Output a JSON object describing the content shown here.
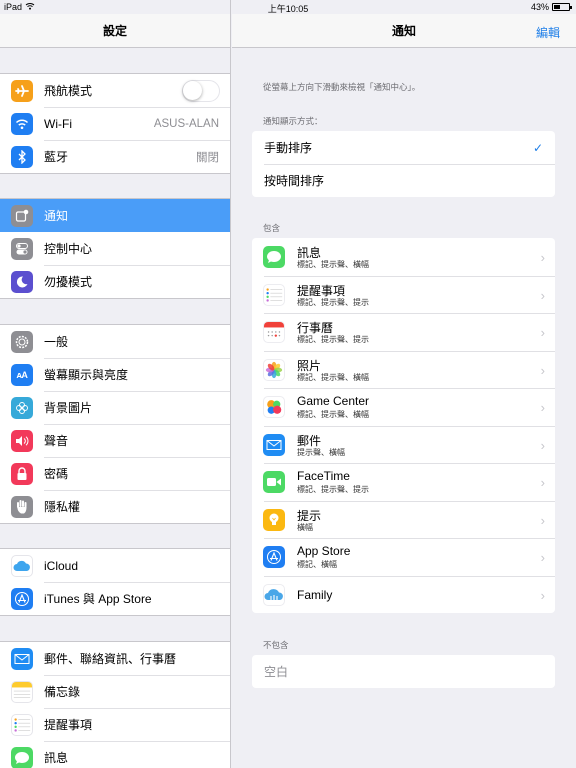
{
  "status_bar": {
    "device": "iPad",
    "time": "上午10:05",
    "battery_percent_label": "43%",
    "battery_level": 0.43
  },
  "master": {
    "title": "設定",
    "groups": [
      [
        {
          "label": "飛航模式",
          "icon": "airplane-icon",
          "color": "#f6a01a",
          "accessory": "toggle",
          "toggle_on": false
        },
        {
          "label": "Wi-Fi",
          "icon": "wifi-icon",
          "color": "#1f7ef2",
          "value": "ASUS-ALAN"
        },
        {
          "label": "藍牙",
          "icon": "bluetooth-icon",
          "color": "#1f7ef2",
          "value": "關閉"
        }
      ],
      [
        {
          "label": "通知",
          "icon": "notifications-icon",
          "color": "#8e8e93",
          "selected": true
        },
        {
          "label": "控制中心",
          "icon": "control-center-icon",
          "color": "#8e8e93"
        },
        {
          "label": "勿擾模式",
          "icon": "moon-icon",
          "color": "#5b4fcf"
        }
      ],
      [
        {
          "label": "一般",
          "icon": "gear-icon",
          "color": "#8e8e93"
        },
        {
          "label": "螢幕顯示與亮度",
          "icon": "display-icon",
          "color": "#1f7ef2"
        },
        {
          "label": "背景圖片",
          "icon": "wallpaper-icon",
          "color": "#36a9d9"
        },
        {
          "label": "聲音",
          "icon": "speaker-icon",
          "color": "#f2395a"
        },
        {
          "label": "密碼",
          "icon": "lock-icon",
          "color": "#f2395a"
        },
        {
          "label": "隱私權",
          "icon": "hand-icon",
          "color": "#8e8e93"
        }
      ],
      [
        {
          "label": "iCloud",
          "icon": "icloud-icon",
          "color": "#ffffff"
        },
        {
          "label": "iTunes 與 App Store",
          "icon": "app-store-icon",
          "color": "#1f7ef2"
        }
      ],
      [
        {
          "label": "郵件、聯絡資訊、行事曆",
          "icon": "mail-icon",
          "color": "#1f8cf3"
        },
        {
          "label": "備忘錄",
          "icon": "notes-icon",
          "color": "#ffffff"
        },
        {
          "label": "提醒事項",
          "icon": "reminders-icon",
          "color": "#ffffff"
        },
        {
          "label": "訊息",
          "icon": "messages-icon",
          "color": "#4cd964"
        }
      ]
    ]
  },
  "detail": {
    "title": "通知",
    "edit_label": "編輯",
    "hint": "從螢幕上方向下滑動來檢視「通知中心」。",
    "sort_header": "通知顯示方式：",
    "sort_options": [
      {
        "label": "手動排序",
        "checked": true
      },
      {
        "label": "按時間排序",
        "checked": false
      }
    ],
    "include_header": "包含",
    "included_apps": [
      {
        "name": "訊息",
        "detail": "標記、提示聲、橫幅",
        "icon": "messages-icon"
      },
      {
        "name": "提醒事項",
        "detail": "標記、提示聲、提示",
        "icon": "reminders-icon"
      },
      {
        "name": "行事曆",
        "detail": "標記、提示聲、提示",
        "icon": "calendar-icon"
      },
      {
        "name": "照片",
        "detail": "標記、提示聲、橫幅",
        "icon": "photos-icon"
      },
      {
        "name": "Game Center",
        "detail": "標記、提示聲、橫幅",
        "icon": "game-center-icon"
      },
      {
        "name": "郵件",
        "detail": "提示聲、橫幅",
        "icon": "mail-icon"
      },
      {
        "name": "FaceTime",
        "detail": "標記、提示聲、提示",
        "icon": "facetime-icon"
      },
      {
        "name": "提示",
        "detail": "橫幅",
        "icon": "tips-icon"
      },
      {
        "name": "App Store",
        "detail": "標記、橫幅",
        "icon": "app-store-icon"
      },
      {
        "name": "Family",
        "detail": "",
        "icon": "family-icon"
      }
    ],
    "exclude_header": "不包含",
    "excluded_empty": "空白"
  },
  "colors": {
    "accent": "#1d7ee8",
    "selected_row": "#4a9df8"
  }
}
